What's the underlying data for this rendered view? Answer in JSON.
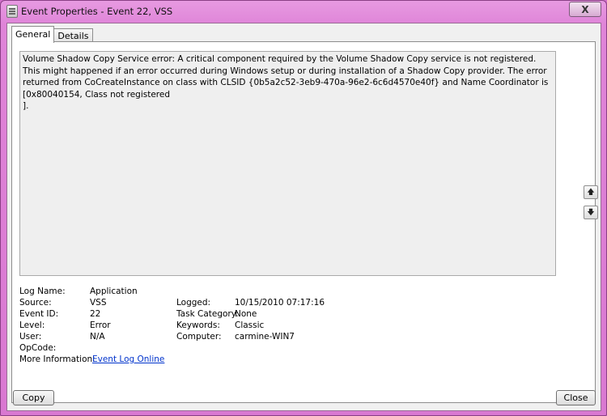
{
  "window": {
    "title": "Event Properties - Event 22, VSS",
    "close_glyph": "X"
  },
  "tabs": [
    {
      "label": "General",
      "active": true
    },
    {
      "label": "Details",
      "active": false
    }
  ],
  "description": "Volume Shadow Copy Service error: A critical component required by the Volume Shadow Copy service is not registered. This might happened if an error occurred during Windows setup or during installation of a Shadow Copy provider. The error returned from CoCreateInstance on class with CLSID {0b5a2c52-3eb9-470a-96e2-6c6d4570e40f} and Name Coordinator is [0x80040154, Class not registered\n].",
  "nav": {
    "up_glyph": "🡅",
    "down_glyph": "🡇"
  },
  "fields": {
    "log_name": {
      "label": "Log Name:",
      "value": "Application"
    },
    "source": {
      "label": "Source:",
      "value": "VSS"
    },
    "event_id": {
      "label": "Event ID:",
      "value": "22"
    },
    "level": {
      "label": "Level:",
      "value": "Error"
    },
    "user": {
      "label": "User:",
      "value": "N/A"
    },
    "opcode": {
      "label": "OpCode:",
      "value": ""
    },
    "more_info": {
      "label": "More Information:",
      "value": "Event Log Online"
    },
    "logged": {
      "label": "Logged:",
      "value": "10/15/2010 07:17:16"
    },
    "task_category": {
      "label": "Task Category:",
      "value": "None"
    },
    "keywords": {
      "label": "Keywords:",
      "value": "Classic"
    },
    "computer": {
      "label": "Computer:",
      "value": "carmine-WIN7"
    }
  },
  "buttons": {
    "copy": "Copy",
    "close": "Close"
  },
  "colors": {
    "accent_frame": "#d978d1",
    "link": "#0033cc"
  }
}
